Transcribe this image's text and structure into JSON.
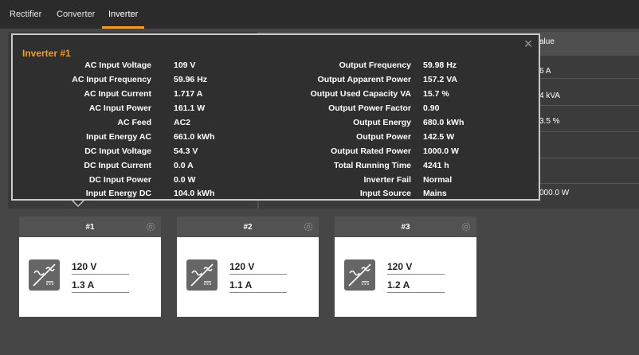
{
  "tabs": [
    {
      "label": "Rectifier"
    },
    {
      "label": "Converter"
    },
    {
      "label": "Inverter",
      "active": true
    }
  ],
  "background_table": {
    "header_label": "alue",
    "values": [
      "6 A",
      "4 kVA",
      "3.5 %",
      "000.0 W"
    ]
  },
  "popup": {
    "title": "Inverter #1",
    "left": [
      {
        "label": "AC Input Voltage",
        "value": "109 V"
      },
      {
        "label": "AC Input Frequency",
        "value": "59.96 Hz"
      },
      {
        "label": "AC Input Current",
        "value": "1.717 A"
      },
      {
        "label": "AC Input Power",
        "value": "161.1 W"
      },
      {
        "label": "AC Feed",
        "value": "AC2"
      },
      {
        "label": "Input Energy AC",
        "value": "661.0 kWh"
      },
      {
        "label": "DC Input Voltage",
        "value": "54.3 V"
      },
      {
        "label": "DC Input Current",
        "value": "0.0 A"
      },
      {
        "label": "DC Input Power",
        "value": "0.0 W"
      },
      {
        "label": "Input Energy DC",
        "value": "104.0 kWh"
      }
    ],
    "right": [
      {
        "label": "Output Frequency",
        "value": "59.98 Hz"
      },
      {
        "label": "Output Apparent Power",
        "value": "157.2 VA"
      },
      {
        "label": "Output Used Capacity VA",
        "value": "15.7 %"
      },
      {
        "label": "Output Power Factor",
        "value": "0.90"
      },
      {
        "label": "Output Energy",
        "value": "680.0 kWh"
      },
      {
        "label": "Output Power",
        "value": "142.5 W"
      },
      {
        "label": "Output Rated Power",
        "value": "1000.0 W"
      },
      {
        "label": "Total Running Time",
        "value": "4241 h"
      },
      {
        "label": "Inverter Fail",
        "value": "Normal"
      },
      {
        "label": "Input Source",
        "value": "Mains"
      }
    ]
  },
  "cards": [
    {
      "title": "#1",
      "voltage": "120 V",
      "current": "1.3 A"
    },
    {
      "title": "#2",
      "voltage": "120 V",
      "current": "1.1 A"
    },
    {
      "title": "#3",
      "voltage": "120 V",
      "current": "1.2 A"
    }
  ],
  "colors": {
    "accent": "#f59a23"
  },
  "icons": {
    "close": "close-icon",
    "settings": "gear-icon",
    "inverter": "inverter-icon"
  }
}
